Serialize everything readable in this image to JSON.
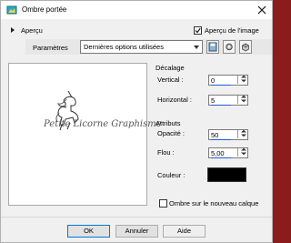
{
  "window": {
    "title": "Ombre portée"
  },
  "preview_toggle": {
    "label": "Aperçu"
  },
  "preview_on_image": {
    "label": "Aperçu de l'image",
    "checked": true
  },
  "presets": {
    "label": "Paramètres",
    "selected": "Dernières options utilisées"
  },
  "preview_image": {
    "signature": "Petite Licorne Graphisme"
  },
  "offset": {
    "title": "Décalage",
    "vertical": {
      "label": "Vertical :",
      "value": "0"
    },
    "horizontal": {
      "label": "Horizontal :",
      "value": "5"
    }
  },
  "attributes": {
    "title": "Attributs",
    "opacity": {
      "label": "Opacité :",
      "value": "50"
    },
    "blur": {
      "label": "Flou :",
      "value": "5,00"
    },
    "color": {
      "label": "Couleur :",
      "value": "#000000"
    }
  },
  "new_layer": {
    "label": "Ombre sur le nouveau calque",
    "checked": false
  },
  "buttons": {
    "ok": "OK",
    "cancel": "Annuler",
    "help": "Aide"
  }
}
